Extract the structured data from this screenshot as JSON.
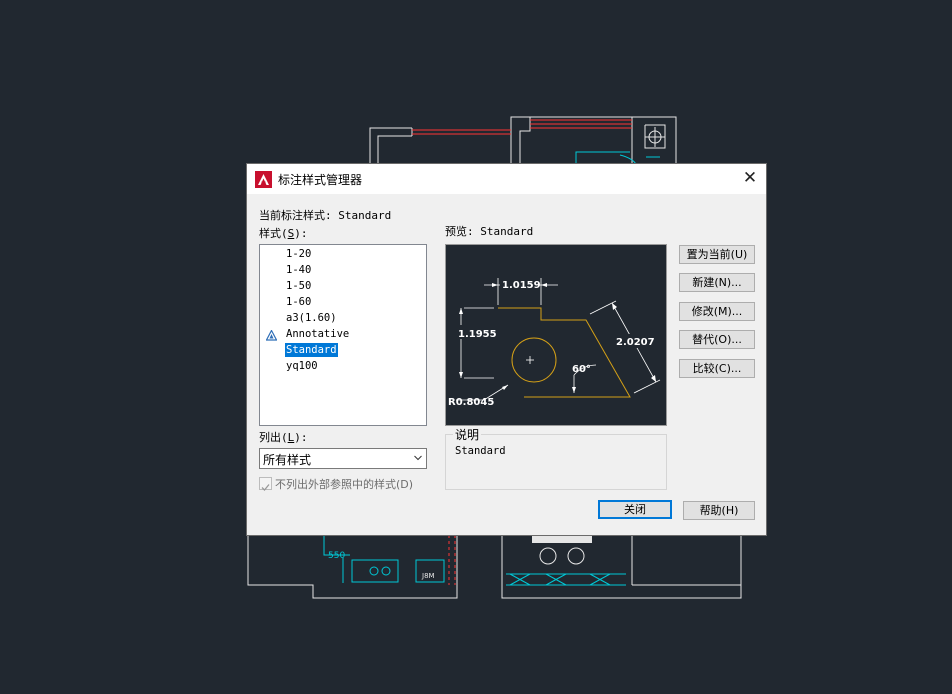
{
  "dialog": {
    "title": "标注样式管理器",
    "current_style_label": "当前标注样式: Standard",
    "styles_label": "样式(",
    "styles_key": "S",
    "styles_label_end": "):",
    "styles": [
      "1-20",
      "1-40",
      "1-50",
      "1-60",
      "a3(1.60)",
      "Annotative",
      "Standard",
      "yq100"
    ],
    "selected_style": "Standard",
    "preview_label": "预览: Standard",
    "list_label": "列出(",
    "list_key": "L",
    "list_label_end": "):",
    "list_value": "所有样式",
    "exclude_xref_label": "不列出外部参照中的样式(D)",
    "exclude_xref_checked": true,
    "description_label": "说明",
    "description_text": "Standard",
    "buttons": {
      "set_current": "置为当前(U)",
      "new": "新建(N)...",
      "modify": "修改(M)...",
      "override": "替代(O)...",
      "compare": "比较(C)...",
      "close": "关闭",
      "help": "帮助(H)"
    }
  },
  "preview": {
    "dim_top": "1.0159",
    "dim_left": "1.1955",
    "dim_right": "2.0207",
    "dim_angle": "60°",
    "dim_radius": "R0.8045"
  },
  "colors": {
    "background": "#212830",
    "selection": "#0078d7",
    "shape_outline": "#d4a017",
    "cad_red": "#ff3333",
    "cad_cyan": "#00c8d6"
  }
}
